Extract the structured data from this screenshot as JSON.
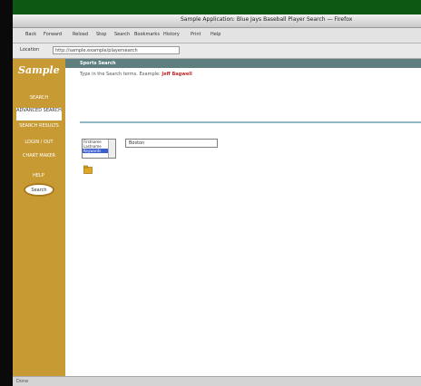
{
  "window": {
    "title": "Sample Application: Blue Jays Baseball Player Search — Firefox"
  },
  "toolbar": {
    "items": [
      "Back",
      "Forward",
      "Reload",
      "Stop",
      "Search",
      "Bookmarks",
      "History",
      "Print",
      "Help"
    ]
  },
  "address": {
    "label": "Location",
    "url": "http://sample.example/playersearch"
  },
  "sidebar": {
    "logo": "Sample",
    "items": [
      "SEARCH",
      "ADVANCED SEARCH",
      "SEARCH RESULTS",
      "LOGIN / OUT",
      "CHART MAKER"
    ],
    "help_label": "HELP",
    "oval_button_label": "Search"
  },
  "page": {
    "band_title": "Sports Search",
    "instruction": "Type in the Search terms. Example:",
    "instruction_highlight": "Jeff Bagwell",
    "listbox_options": [
      "Firstname",
      "Lastname",
      "Keywords"
    ],
    "selected_option": "Keywords",
    "search_value": "Boston"
  },
  "status": {
    "text": "Done"
  },
  "colors": {
    "sidebar": "#c89a34",
    "topband": "#5f7f7f",
    "accent": "#c0282a"
  }
}
